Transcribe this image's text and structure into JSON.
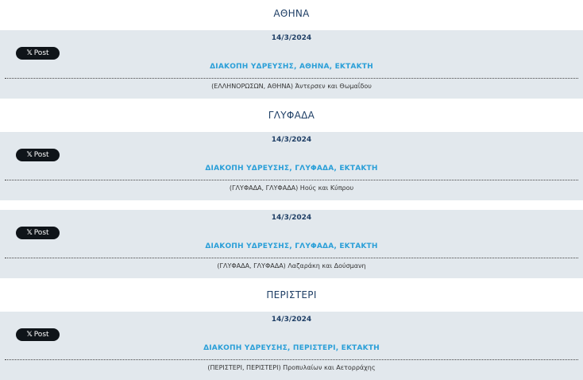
{
  "sections": [
    {
      "city": "ΑΘΗΝΑ",
      "notices": [
        {
          "date": "14/3/2024",
          "title": "ΔΙΑΚΟΠΗ ΥΔΡΕΥΣΗΣ, ΑΘΗΝΑ, ΕΚΤΑΚΤΗ",
          "address": "(ΕΛΛΗΝΟΡΩΣΩΝ, ΑΘΗΝΑ) Άντερσεν και Θωμαΐδου",
          "share_label": "Post"
        }
      ]
    },
    {
      "city": "ΓΛΥΦΑΔΑ",
      "notices": [
        {
          "date": "14/3/2024",
          "title": "ΔΙΑΚΟΠΗ ΥΔΡΕΥΣΗΣ, ΓΛΥΦΑΔΑ, ΕΚΤΑΚΤΗ",
          "address": "(ΓΛΥΦΑΔΑ, ΓΛΥΦΑΔΑ) Ηούς και Κύπρου",
          "share_label": "Post"
        },
        {
          "date": "14/3/2024",
          "title": "ΔΙΑΚΟΠΗ ΥΔΡΕΥΣΗΣ, ΓΛΥΦΑΔΑ, ΕΚΤΑΚΤΗ",
          "address": "(ΓΛΥΦΑΔΑ, ΓΛΥΦΑΔΑ) Λαζαράκη και Δούσμανη",
          "share_label": "Post"
        }
      ]
    },
    {
      "city": "ΠΕΡΙΣΤΕΡΙ",
      "notices": [
        {
          "date": "14/3/2024",
          "title": "ΔΙΑΚΟΠΗ ΥΔΡΕΥΣΗΣ, ΠΕΡΙΣΤΕΡΙ, ΕΚΤΑΚΤΗ",
          "address": "(ΠΕΡΙΣΤΕΡΙ, ΠΕΡΙΣΤΕΡΙ) Προπυλαίων και Αετορράχης",
          "share_label": "Post"
        }
      ]
    }
  ],
  "icons": {
    "share": "x-logo-icon"
  },
  "colors": {
    "panel": "#e2e8ed",
    "city": "#1f3f66",
    "title": "#2a9fd8",
    "button": "#0f1419"
  }
}
